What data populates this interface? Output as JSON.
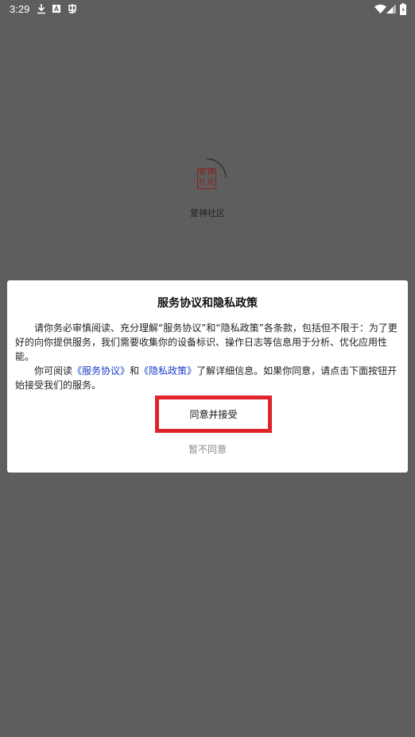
{
  "status_bar": {
    "time": "3:29",
    "icons": [
      "download-icon",
      "a-box-icon",
      "bug-icon",
      "wifi-icon",
      "signal-icon",
      "battery-icon"
    ]
  },
  "splash": {
    "logo_chars": [
      "爱",
      "神",
      "社",
      "区"
    ],
    "app_name": "爱神社区"
  },
  "dialog": {
    "title": "服务协议和隐私政策",
    "paragraph1": "请你务必审慎阅读、充分理解“服务协议”和“隐私政策”各条款，包括但不限于：为了更好的向你提供服务，我们需要收集你的设备标识、操作日志等信息用于分析、优化应用性能。",
    "p2_prefix": "你可阅读",
    "service_link": "《服务协议》",
    "p2_and": "和",
    "privacy_link": "《隐私政策》",
    "p2_suffix": "了解详细信息。如果你同意，请点击下面按钮开始接受我们的服务。",
    "accept_label": "同意并接受",
    "decline_label": "暂不同意"
  },
  "colors": {
    "backdrop": "#5e5e5e",
    "link": "#1a3cc8",
    "highlight_border": "#e0242c",
    "logo": "#8b2020"
  }
}
